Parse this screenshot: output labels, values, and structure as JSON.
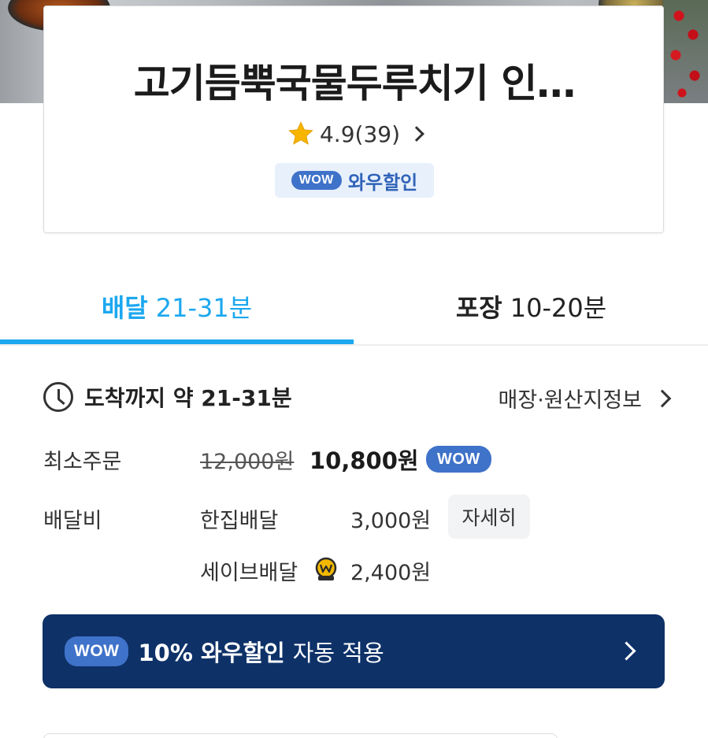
{
  "store": {
    "title": "고기듬뿍국물두루치기 인…",
    "rating": "4.9(39)"
  },
  "wow_badge": {
    "pill": "WOW",
    "label": "와우할인"
  },
  "tabs": [
    {
      "name": "배달",
      "time": "21-31분",
      "active": true
    },
    {
      "name": "포장",
      "time": "10-20분",
      "active": false
    }
  ],
  "arrival": "도착까지 약 21-31분",
  "store_info_link": "매장·원산지정보",
  "min_order": {
    "label": "최소주문",
    "original": "12,000원",
    "discounted": "10,800원",
    "badge": "WOW"
  },
  "delivery_fee": {
    "label": "배달비",
    "options": [
      {
        "name": "한집배달",
        "price": "3,000원"
      },
      {
        "name": "세이브배달",
        "price": "2,400원"
      }
    ],
    "detail_button": "자세히"
  },
  "banner": {
    "pill": "WOW",
    "percent": "10% 와우할인",
    "text": "자동 적용"
  },
  "colors": {
    "accent_blue": "#1ba8ef",
    "wow_blue": "#3f72c9",
    "banner_navy": "#0e3168"
  }
}
